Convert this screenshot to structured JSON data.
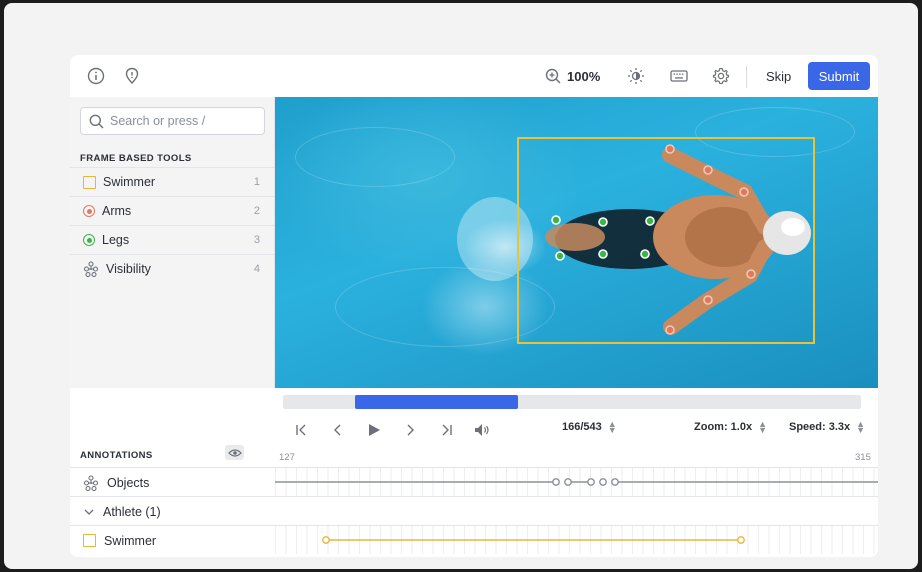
{
  "toolbar": {
    "zoom_level": "100%",
    "skip_label": "Skip",
    "submit_label": "Submit",
    "icons": [
      "info-icon",
      "pin-icon",
      "zoom-in-icon",
      "brightness-icon",
      "keyboard-icon",
      "settings-icon"
    ]
  },
  "sidebar": {
    "search_placeholder": "Search or press /",
    "section_title": "FRAME BASED TOOLS",
    "tools": [
      {
        "label": "Swimmer",
        "shortcut": "1",
        "icon": "bounding-box-icon",
        "color": "#e8b53a"
      },
      {
        "label": "Arms",
        "shortcut": "2",
        "icon": "point-icon",
        "color": "#e07a5f"
      },
      {
        "label": "Legs",
        "shortcut": "3",
        "icon": "point-icon",
        "color": "#3bb54a"
      },
      {
        "label": "Visibility",
        "shortcut": "4",
        "icon": "skeleton-icon",
        "color": "#6b7079"
      }
    ]
  },
  "player": {
    "frame_counter": "166/543",
    "zoom": "Zoom: 1.0x",
    "speed": "Speed: 3.3x",
    "progress_start_fraction": 0.125,
    "progress_end_fraction": 0.406
  },
  "annotations": {
    "title": "ANNOTATIONS",
    "range_start": "127",
    "range_end": "315",
    "rows": [
      {
        "label": "Objects",
        "icon": "skeleton-icon"
      },
      {
        "label": "Athlete (1)",
        "icon": "chevron-down-icon"
      },
      {
        "label": "Swimmer",
        "icon": "bounding-box-icon"
      }
    ]
  },
  "colors": {
    "accent": "#3a66e8",
    "box": "#e8c33a",
    "arms_point": "#e07a5f",
    "legs_point": "#3bb54a"
  }
}
